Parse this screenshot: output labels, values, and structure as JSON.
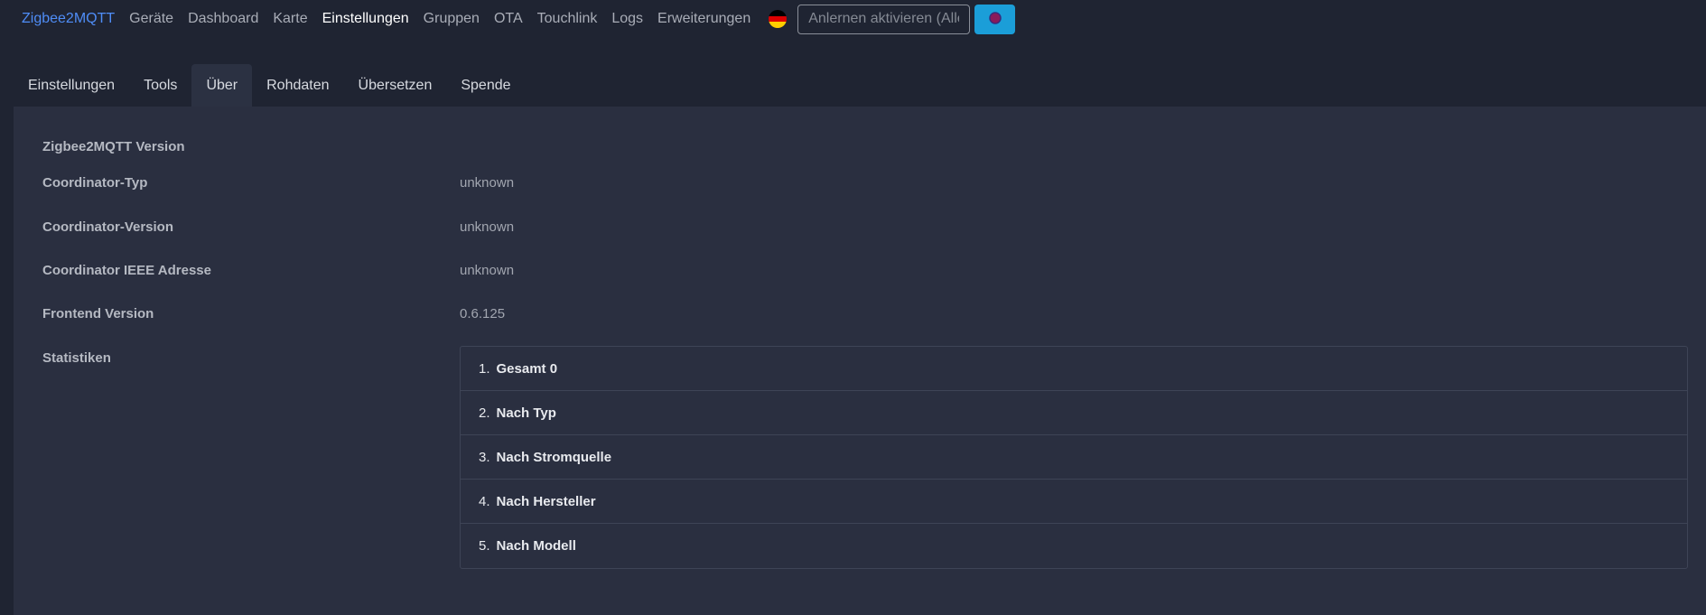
{
  "navbar": {
    "brand": "Zigbee2MQTT",
    "links": [
      {
        "label": "Geräte",
        "active": false
      },
      {
        "label": "Dashboard",
        "active": false
      },
      {
        "label": "Karte",
        "active": false
      },
      {
        "label": "Einstellungen",
        "active": true
      },
      {
        "label": "Gruppen",
        "active": false
      },
      {
        "label": "OTA",
        "active": false
      },
      {
        "label": "Touchlink",
        "active": false
      },
      {
        "label": "Logs",
        "active": false
      },
      {
        "label": "Erweiterungen",
        "active": false
      }
    ],
    "language_icon": "german-flag-icon",
    "permit_join_placeholder": "Anlernen aktivieren (Alle)",
    "permit_join_button_icon": "permit-join-icon",
    "accent_color": "#1b9ed8",
    "brand_color": "#4f8df7"
  },
  "tabs": [
    {
      "label": "Einstellungen",
      "active": false
    },
    {
      "label": "Tools",
      "active": false
    },
    {
      "label": "Über",
      "active": true
    },
    {
      "label": "Rohdaten",
      "active": false
    },
    {
      "label": "Übersetzen",
      "active": false
    },
    {
      "label": "Spende",
      "active": false
    }
  ],
  "about": {
    "rows": [
      {
        "label": "Zigbee2MQTT Version",
        "value": ""
      },
      {
        "label": "Coordinator-Typ",
        "value": "unknown"
      },
      {
        "label": "Coordinator-Version",
        "value": "unknown"
      },
      {
        "label": "Coordinator IEEE Adresse",
        "value": "unknown"
      },
      {
        "label": "Frontend Version",
        "value": "0.6.125"
      }
    ],
    "stats_label": "Statistiken",
    "stats": [
      {
        "num": "1.",
        "label": "Gesamt 0"
      },
      {
        "num": "2.",
        "label": "Nach Typ"
      },
      {
        "num": "3.",
        "label": "Nach Stromquelle"
      },
      {
        "num": "4.",
        "label": "Nach Hersteller"
      },
      {
        "num": "5.",
        "label": "Nach Modell"
      }
    ]
  }
}
